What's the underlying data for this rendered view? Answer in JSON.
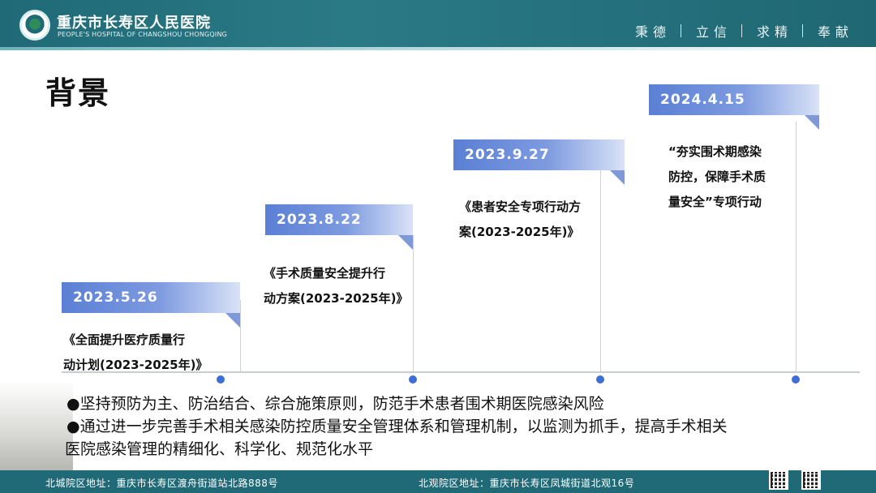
{
  "header": {
    "hospital_name_cn": "重庆市长寿区人民医院",
    "hospital_name_en": "PEOPLE'S HOSPITAL OF CHANGSHOU CHONGQING",
    "mottos": [
      "秉德",
      "立信",
      "求精",
      "奉献"
    ]
  },
  "page_title": "背景",
  "timeline": [
    {
      "date": "2023.5.26",
      "plan_line1": "《全面提升医疗质量行",
      "plan_line2": "动计划(2023-2025年)》"
    },
    {
      "date": "2023.8.22",
      "plan_line1": "《手术质量安全提升行",
      "plan_line2": "动方案(2023-2025年)》"
    },
    {
      "date": "2023.9.27",
      "plan_line1": "《患者安全专项行动方",
      "plan_line2": "案(2023-2025年)》"
    },
    {
      "date": "2024.4.15",
      "plan_line1": "“夯实围术期感染",
      "plan_line2": "防控，保障手术质",
      "plan_line3": "量安全”专项行动"
    }
  ],
  "bullets": [
    "●坚持预防为主、防治结合、综合施策原则，防范手术患者围术期医院感染风险",
    "●通过进一步完善手术相关感染防控质量安全管理体系和管理机制，以监测为抓手，提高手术相关",
    "医院感染管理的精细化、科学化、规范化水平"
  ],
  "footer": {
    "address_north_city": "北城院区地址：重庆市长寿区渡舟街道站北路888号",
    "address_north_view": "北观院区地址：重庆市长寿区凤城街道北观16号"
  },
  "colors": {
    "header_teal": "#1f6a76",
    "date_blue": "#5a7fd4",
    "dot_blue": "#3d6fd6"
  }
}
